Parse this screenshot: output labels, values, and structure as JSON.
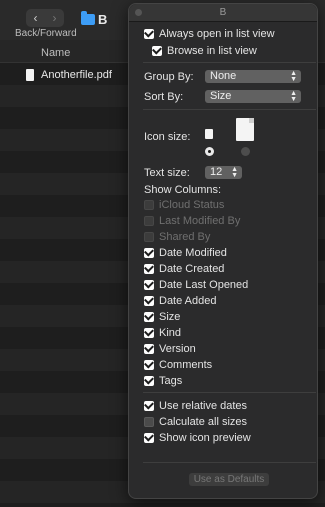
{
  "finder": {
    "nav_label": "Back/Forward",
    "back_glyph": "‹",
    "forward_glyph": "›",
    "folder_title": "B",
    "column_header": "Name",
    "file_name": "Anotherfile.pdf"
  },
  "panel": {
    "title": "B",
    "always_open_label": "Always open in list view",
    "browse_label": "Browse in list view",
    "group_by_label": "Group By:",
    "group_by_value": "None",
    "sort_by_label": "Sort By:",
    "sort_by_value": "Size",
    "icon_size_label": "Icon size:",
    "text_size_label": "Text size:",
    "text_size_value": "12",
    "show_columns_label": "Show Columns:",
    "columns": [
      {
        "label": "iCloud Status",
        "checked": false,
        "enabled": false
      },
      {
        "label": "Last Modified By",
        "checked": false,
        "enabled": false
      },
      {
        "label": "Shared By",
        "checked": false,
        "enabled": false
      },
      {
        "label": "Date Modified",
        "checked": true,
        "enabled": true
      },
      {
        "label": "Date Created",
        "checked": true,
        "enabled": true
      },
      {
        "label": "Date Last Opened",
        "checked": true,
        "enabled": true
      },
      {
        "label": "Date Added",
        "checked": true,
        "enabled": true
      },
      {
        "label": "Size",
        "checked": true,
        "enabled": true
      },
      {
        "label": "Kind",
        "checked": true,
        "enabled": true
      },
      {
        "label": "Version",
        "checked": true,
        "enabled": true
      },
      {
        "label": "Comments",
        "checked": true,
        "enabled": true
      },
      {
        "label": "Tags",
        "checked": true,
        "enabled": true
      }
    ],
    "use_relative_dates_label": "Use relative dates",
    "calculate_sizes_label": "Calculate all sizes",
    "show_icon_preview_label": "Show icon preview",
    "use_as_defaults_label": "Use as Defaults"
  }
}
